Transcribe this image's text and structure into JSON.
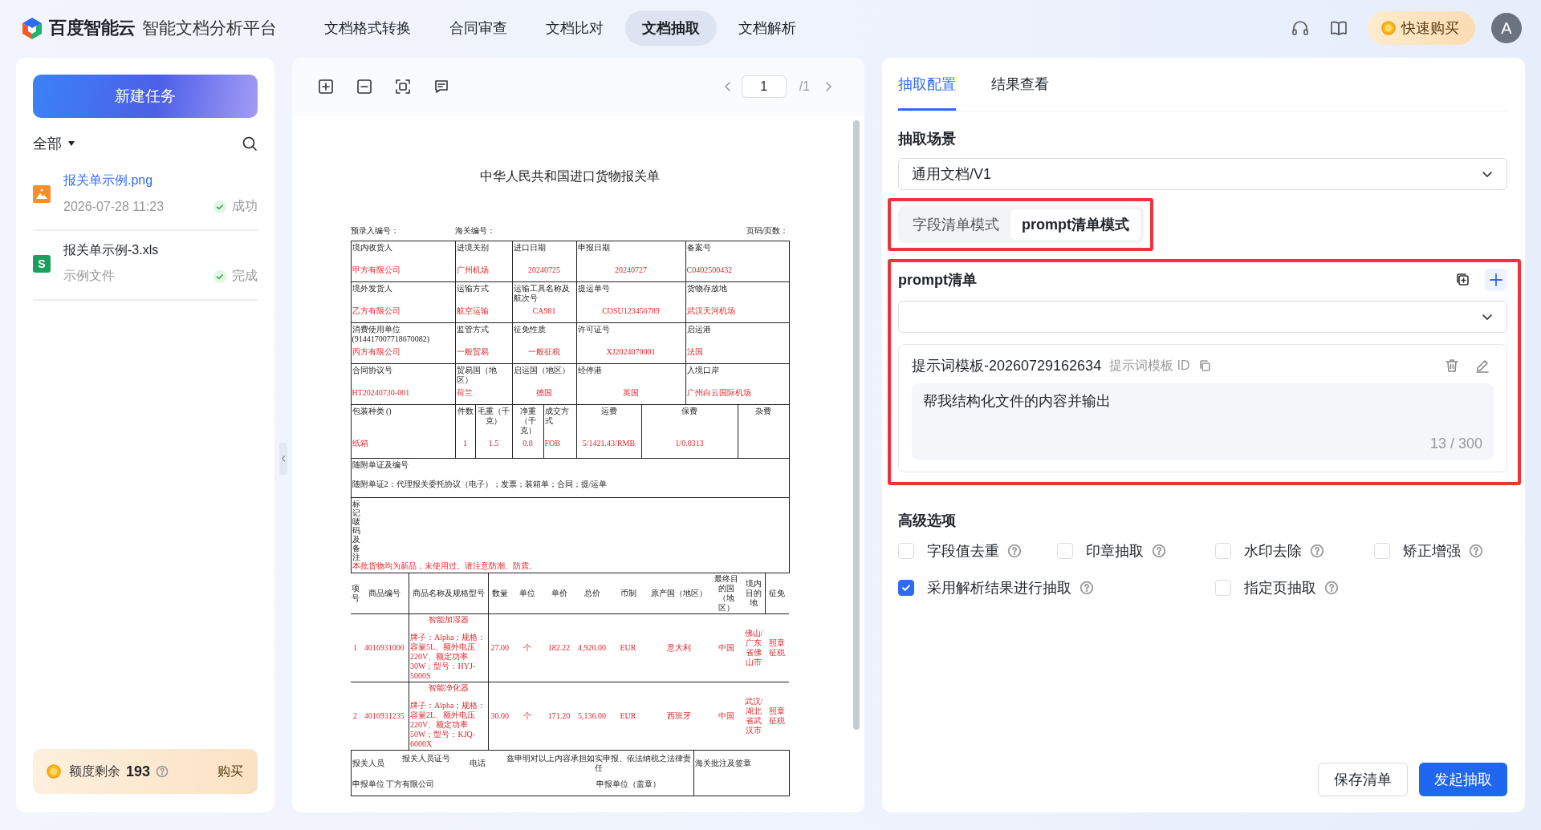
{
  "topbar": {
    "brand": "百度智能云",
    "product": "智能文档分析平台",
    "nav": [
      {
        "label": "文档格式转换",
        "selected": false
      },
      {
        "label": "合同审查",
        "selected": false
      },
      {
        "label": "文档比对",
        "selected": false
      },
      {
        "label": "文档抽取",
        "selected": true
      },
      {
        "label": "文档解析",
        "selected": false
      }
    ],
    "buy_button": "快速购买",
    "avatar": "A"
  },
  "sidebar": {
    "new_task": "新建任务",
    "filter": "全部",
    "files": [
      {
        "kind": "image",
        "name": "报关单示例.png",
        "meta": "2026-07-28 11:23",
        "status": "成功",
        "selected": true
      },
      {
        "kind": "sheet",
        "badge": "S",
        "name": "报关单示例-3.xls",
        "meta": "示例文件",
        "status": "完成",
        "selected": false
      }
    ],
    "quota": {
      "label": "额度剩余",
      "value": "193",
      "action": "购买"
    }
  },
  "viewer": {
    "page": "1",
    "total": "/1",
    "document": {
      "title": "中华人民共和国进口货物报关单",
      "header": [
        "预录入编号：",
        "海关编号：",
        "页码/页数："
      ],
      "declaration_rows": [
        [
          {
            "label": "境内收货人",
            "value": "甲方有限公司"
          },
          {
            "label": "进境关别",
            "value": "广州机场"
          },
          {
            "label": "进口日期",
            "value": "20240725"
          },
          {
            "label": "申报日期",
            "value": "20240727"
          },
          {
            "label": "备案号",
            "value": "C0402500432"
          }
        ],
        [
          {
            "label": "境外发货人",
            "value": "乙方有限公司"
          },
          {
            "label": "运输方式",
            "value": "航空运输"
          },
          {
            "label": "运输工具名称及航次号",
            "value": "CA981"
          },
          {
            "label": "提运单号",
            "value": "COSU123456789"
          },
          {
            "label": "货物存放地",
            "value": "武汉天河机场"
          }
        ],
        [
          {
            "label": "消费使用单位(914417007718670082)",
            "value": "丙方有限公司"
          },
          {
            "label": "监管方式",
            "value": "一般贸易"
          },
          {
            "label": "征免性质",
            "value": "一般征税"
          },
          {
            "label": "许可证号",
            "value": "XJ2024070001"
          },
          {
            "label": "启运港",
            "value": "法国"
          }
        ],
        [
          {
            "label": "合同协议号",
            "value": "HT20240730-001"
          },
          {
            "label": "贸易国（地区）",
            "value": "荷兰"
          },
          {
            "label": "启运国（地区）",
            "value": "德国"
          },
          {
            "label": "经停港",
            "value": "英国"
          },
          {
            "label": "入境口岸",
            "value": "广州白云国际机场"
          }
        ]
      ],
      "packing_row": [
        {
          "label": "包装种类 ()",
          "value": "纸箱"
        },
        {
          "label": "件数",
          "value": "1"
        },
        {
          "label": "毛重（千克）",
          "value": "1.5"
        },
        {
          "label": "净重（千克）",
          "value": "0.8"
        },
        {
          "label": "成交方式",
          "value": "FOB"
        },
        {
          "label": "运费",
          "value": "5/1421.43/RMB"
        },
        {
          "label": "保费",
          "value": "1/0.0313"
        },
        {
          "label": "杂费"
        }
      ],
      "attachments": {
        "label": "随附单证及编号",
        "value": "随附单证2：代理报关委托协议（电子）；发票；装箱单；合同；提/运单"
      },
      "marks": {
        "label": "标记唛码及备注",
        "value": "本批货物均为新品，未使用过。请注意防潮、防震。"
      },
      "goods_columns": [
        "项号",
        "商品编号",
        "商品名称及规格型号",
        "数量",
        "单位",
        "单价",
        "总价",
        "币制",
        "原产国（地区）",
        "最终目的国（地区）",
        "境内目的地",
        "征免"
      ],
      "goods_rows": [
        {
          "no": "1",
          "code": "4016931000",
          "name": "智能加湿器",
          "spec": "牌子：Alpha；规格：容量5L、额外电压220V、额定功率30W；型号：HYJ-5000S",
          "qty": "27.00",
          "unit": "个",
          "price": "182.22",
          "total": "4,920.00",
          "currency": "EUR",
          "origin": "意大利",
          "country": "中国",
          "destination": "佛山/广东省佛山市",
          "exemption": "照章征税"
        },
        {
          "no": "2",
          "code": "4016931235",
          "name": "智能净化器",
          "spec": "牌子：Alpha；规格：容量2L、额外电压220V、额定功率50W；型号：KJQ-6000X",
          "qty": "30.00",
          "unit": "个",
          "price": "171.20",
          "total": "5,136.00",
          "currency": "EUR",
          "origin": "西班牙",
          "country": "中国",
          "destination": "武汉/湖北省武汉市",
          "exemption": "照章征税"
        }
      ],
      "footer": {
        "declarant": "报关人员",
        "declarant_id": "报关人员证号",
        "phone": "电话",
        "statement": "兹申明对以上内容承担如实申报、依法纳税之法律责任",
        "customs": "海关批注及签章",
        "unit": "申报单位 丁方有限公司",
        "seal": "申报单位（盖章）"
      }
    }
  },
  "panel": {
    "tabs": [
      {
        "label": "抽取配置",
        "selected": true
      },
      {
        "label": "结果查看",
        "selected": false
      }
    ],
    "scene_label": "抽取场景",
    "scene_value": "通用文档/V1",
    "modes": [
      {
        "label": "字段清单模式",
        "selected": false
      },
      {
        "label": "prompt清单模式",
        "selected": true
      }
    ],
    "prompt_list": {
      "label": "prompt清单",
      "template": {
        "name": "提示词模板-20260729162634",
        "id_label": "提示词模板 ID",
        "text": "帮我结构化文件的内容并输出",
        "counter": "13 / 300"
      }
    },
    "advanced": {
      "title": "高级选项",
      "options": [
        {
          "label": "字段值去重",
          "checked": false
        },
        {
          "label": "印章抽取",
          "checked": false
        },
        {
          "label": "水印去除",
          "checked": false
        },
        {
          "label": "矫正增强",
          "checked": false
        },
        {
          "label": "采用解析结果进行抽取",
          "checked": true
        },
        {
          "label": "指定页抽取",
          "checked": false
        }
      ]
    },
    "buttons": [
      {
        "label": "保存清单",
        "kind": "secondary"
      },
      {
        "label": "发起抽取",
        "kind": "primary"
      }
    ]
  }
}
